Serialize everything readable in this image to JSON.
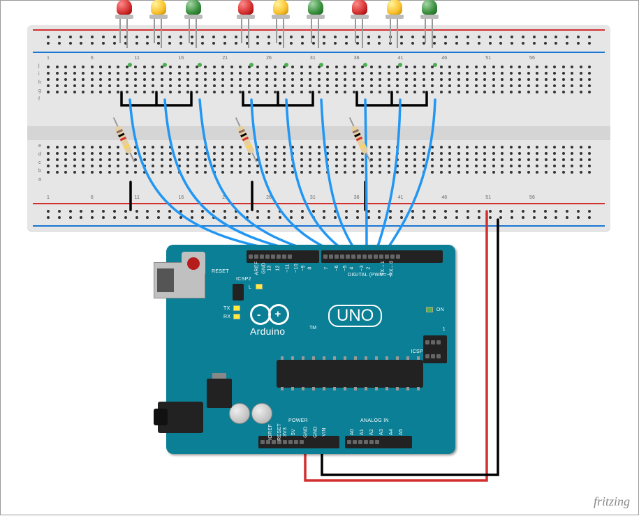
{
  "credit": "fritzing",
  "breadboard": {
    "columns": 63,
    "row_labels_top": [
      "j",
      "i",
      "h",
      "g",
      "f"
    ],
    "row_labels_bottom": [
      "e",
      "d",
      "c",
      "b",
      "a"
    ]
  },
  "leds": [
    {
      "id": "led1",
      "color": "red",
      "group": 1
    },
    {
      "id": "led2",
      "color": "yellow",
      "group": 1
    },
    {
      "id": "led3",
      "color": "green",
      "group": 1
    },
    {
      "id": "led4",
      "color": "red",
      "group": 2
    },
    {
      "id": "led5",
      "color": "yellow",
      "group": 2
    },
    {
      "id": "led6",
      "color": "green",
      "group": 2
    },
    {
      "id": "led7",
      "color": "red",
      "group": 3
    },
    {
      "id": "led8",
      "color": "yellow",
      "group": 3
    },
    {
      "id": "led9",
      "color": "green",
      "group": 3
    }
  ],
  "resistors": [
    {
      "id": "r1",
      "group": 1,
      "bands": [
        "brown",
        "black",
        "red",
        "gold"
      ]
    },
    {
      "id": "r2",
      "group": 2,
      "bands": [
        "brown",
        "black",
        "red",
        "gold"
      ]
    },
    {
      "id": "r3",
      "group": 3,
      "bands": [
        "brown",
        "black",
        "red",
        "gold"
      ]
    }
  ],
  "arduino": {
    "brand": "Arduino",
    "model": "UNO",
    "tm": "TM",
    "labels": {
      "reset": "RESET",
      "icsp2": "ICSP2",
      "l": "L",
      "tx": "TX",
      "rx": "RX",
      "on": "ON",
      "icsp": "ICSP",
      "digital": "DIGITAL (PWM=~)",
      "power": "POWER",
      "analog": "ANALOG IN",
      "aref": "AREF",
      "gnd_top": "GND",
      "d13": "13",
      "d12": "12",
      "d11": "~11",
      "d10": "~10",
      "d9": "~9",
      "d8": "8",
      "d7": "7",
      "d6": "~6",
      "d5": "~5",
      "d4": "4",
      "d3": "~3",
      "d2": "2",
      "tx1": "TX→1",
      "rx0": "RX←0",
      "ioref": "IOREF",
      "reset_pin": "RESET",
      "v33": "3V3",
      "v5": "5V",
      "gnd1": "GND",
      "gnd2": "GND",
      "vin": "VIN",
      "a0": "A0",
      "a1": "A1",
      "a2": "A2",
      "a3": "A3",
      "a4": "A4",
      "a5": "A5",
      "one": "1"
    }
  },
  "wires": {
    "signal_color": "blue",
    "ground_color": "black",
    "power_color": "red",
    "digital_pins_used": [
      "10",
      "9",
      "8",
      "7",
      "6",
      "5",
      "4",
      "3",
      "2"
    ],
    "power_pins_used": [
      "5V",
      "GND"
    ]
  }
}
